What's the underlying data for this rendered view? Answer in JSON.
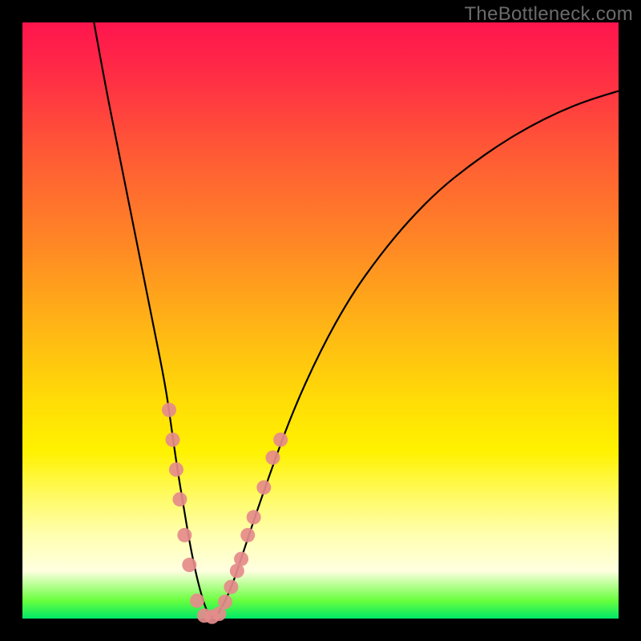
{
  "watermark": "TheBottleneck.com",
  "colors": {
    "frame_bg": "#000000",
    "gradient_top": "#ff154d",
    "gradient_bottom": "#00e868",
    "curve": "#000000",
    "markers": "#e58b8b"
  },
  "chart_data": {
    "type": "line",
    "title": "",
    "xlabel": "",
    "ylabel": "",
    "xlim": [
      0,
      100
    ],
    "ylim": [
      0,
      100
    ],
    "series": [
      {
        "name": "curve",
        "x": [
          12,
          14,
          16,
          18,
          20,
          22,
          24,
          25,
          26,
          27,
          28,
          29,
          30,
          31,
          32,
          33,
          35,
          37,
          40,
          45,
          50,
          55,
          60,
          65,
          70,
          75,
          80,
          85,
          90,
          95,
          100
        ],
        "values": [
          100,
          89,
          79,
          69,
          59,
          49,
          39,
          32,
          25,
          19,
          13,
          8,
          4,
          1,
          0,
          1,
          5,
          11,
          20,
          34,
          45,
          54,
          61,
          67,
          72,
          76,
          79.5,
          82.5,
          85,
          87,
          88.5
        ]
      }
    ],
    "markers": [
      {
        "x": 24.6,
        "y": 35
      },
      {
        "x": 25.2,
        "y": 30
      },
      {
        "x": 25.8,
        "y": 25
      },
      {
        "x": 26.4,
        "y": 20
      },
      {
        "x": 27.2,
        "y": 14
      },
      {
        "x": 28.0,
        "y": 9
      },
      {
        "x": 29.3,
        "y": 3
      },
      {
        "x": 30.5,
        "y": 0.5
      },
      {
        "x": 31.8,
        "y": 0.3
      },
      {
        "x": 33.0,
        "y": 0.8
      },
      {
        "x": 34.0,
        "y": 2.8
      },
      {
        "x": 35.0,
        "y": 5.3
      },
      {
        "x": 36,
        "y": 8
      },
      {
        "x": 36.7,
        "y": 10
      },
      {
        "x": 37.8,
        "y": 14
      },
      {
        "x": 38.8,
        "y": 17
      },
      {
        "x": 40.5,
        "y": 22
      },
      {
        "x": 42.0,
        "y": 27
      },
      {
        "x": 43.3,
        "y": 30
      }
    ]
  }
}
